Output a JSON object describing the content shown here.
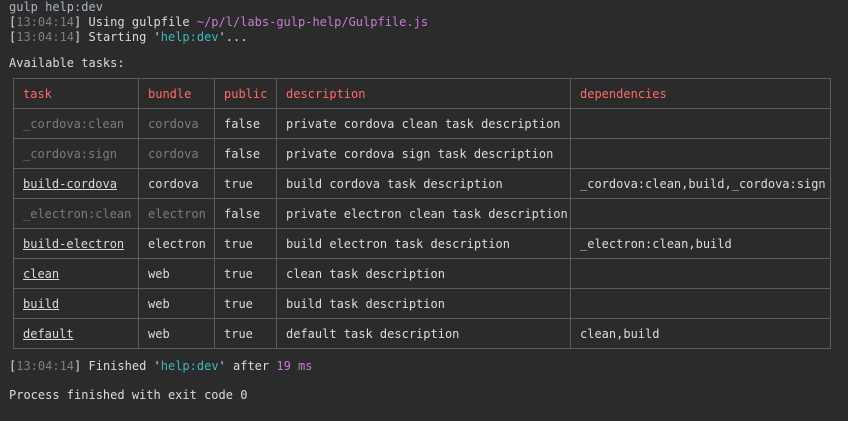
{
  "header_line": "gulp help:dev",
  "log": [
    {
      "ts": "13:04:14",
      "text_before": " Using gulpfile ",
      "highlight": "~/p/l/labs-gulp-help/Gulpfile.js",
      "text_after": ""
    },
    {
      "ts": "13:04:14",
      "text_before": " Starting '",
      "highlight": "help:dev",
      "text_after": "'..."
    }
  ],
  "available_tasks_label": "Available tasks:",
  "table": {
    "headers": [
      "task",
      "bundle",
      "public",
      "description",
      "dependencies"
    ],
    "rows": [
      {
        "task": "_cordova:clean",
        "bundle": "cordova",
        "public": "false",
        "description": "private cordova clean task description",
        "dependencies": ""
      },
      {
        "task": "_cordova:sign",
        "bundle": "cordova",
        "public": "false",
        "description": "private cordova sign task description",
        "dependencies": ""
      },
      {
        "task": "build-cordova",
        "bundle": "cordova",
        "public": "true",
        "description": "build cordova task description",
        "dependencies": "_cordova:clean,build,_cordova:sign"
      },
      {
        "task": "_electron:clean",
        "bundle": "electron",
        "public": "false",
        "description": "private electron clean task description",
        "dependencies": ""
      },
      {
        "task": "build-electron",
        "bundle": "electron",
        "public": "true",
        "description": "build electron task description",
        "dependencies": "_electron:clean,build"
      },
      {
        "task": "clean",
        "bundle": "web",
        "public": "true",
        "description": "clean task description",
        "dependencies": ""
      },
      {
        "task": "build",
        "bundle": "web",
        "public": "true",
        "description": "build task description",
        "dependencies": ""
      },
      {
        "task": "default",
        "bundle": "web",
        "public": "true",
        "description": "default task description",
        "dependencies": "clean,build"
      }
    ]
  },
  "finished": {
    "ts": "13:04:14",
    "text_before": " Finished '",
    "task": "help:dev",
    "text_middle": "' after ",
    "duration": "19 ms"
  },
  "exit_line": "Process finished with exit code 0",
  "colors": {
    "background": "#2b2b2b",
    "text": "#dcdcdc",
    "timestamp": "#7f7f7f",
    "path": "#c67cd6",
    "task_highlight": "#3cb8bf",
    "header": "#ff6b68",
    "muted": "#7c7c7c",
    "border": "#5c5c5c"
  }
}
